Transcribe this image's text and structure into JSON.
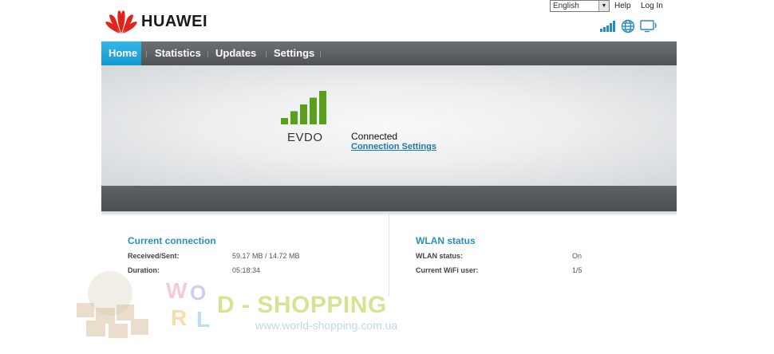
{
  "brand": {
    "name": "HUAWEI"
  },
  "header": {
    "language": "English",
    "help_label": "Help",
    "login_label": "Log In"
  },
  "status_icons": [
    "signal-strength-icon",
    "globe-icon",
    "monitor-icon"
  ],
  "nav": {
    "items": [
      {
        "label": "Home",
        "active": true
      },
      {
        "label": "Statistics",
        "active": false
      },
      {
        "label": "Updates",
        "active": false
      },
      {
        "label": "Settings",
        "active": false
      }
    ]
  },
  "connection": {
    "network_type": "EVDO",
    "state": "Connected",
    "settings_link": "Connection Settings",
    "signal_bars": 5,
    "signal_color": "#5a9e1e"
  },
  "current_connection": {
    "title": "Current connection",
    "rows": [
      {
        "label": "Received/Sent:",
        "value": "59.17 MB / 14.72 MB"
      },
      {
        "label": "Duration:",
        "value": "05:18:34"
      }
    ]
  },
  "wlan": {
    "title": "WLAN status",
    "rows": [
      {
        "label": "WLAN status:",
        "value": "On"
      },
      {
        "label": "Current WiFi user:",
        "value": "1/5"
      }
    ]
  },
  "watermark": {
    "text": "D - SHOPPING",
    "url": "www.world-shopping.com.ua"
  },
  "colors": {
    "accent": "#2a8fbd",
    "nav_active": "#1aa3dc",
    "nav_bg": "#5a5e61"
  }
}
